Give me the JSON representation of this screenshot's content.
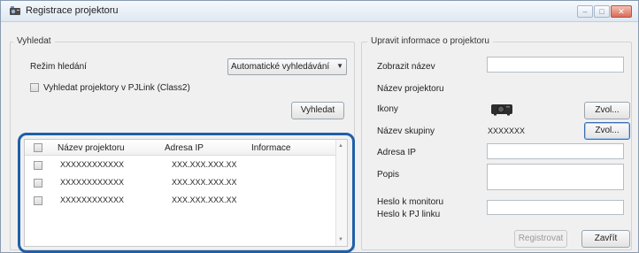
{
  "window": {
    "title": "Registrace projektoru",
    "min_symbol": "–",
    "max_symbol": "□",
    "close_symbol": "✕"
  },
  "search": {
    "group_title": "Vyhledat",
    "mode_label": "Režim hledání",
    "mode_value": "Automatické vyhledávání",
    "mode_arrow": "▼",
    "pjlink_label": "Vyhledat projektory v PJLink (Class2)",
    "search_button": "Vyhledat"
  },
  "list": {
    "columns": [
      "Název projektoru",
      "Adresa IP",
      "Informace"
    ],
    "rows": [
      {
        "name": "XXXXXXXXXXXX",
        "ip": "XXX.XXX.XXX.XX",
        "info": ""
      },
      {
        "name": "XXXXXXXXXXXX",
        "ip": "XXX.XXX.XXX.XX",
        "info": ""
      },
      {
        "name": "XXXXXXXXXXXX",
        "ip": "XXX.XXX.XXX.XX",
        "info": ""
      }
    ],
    "scroll_up": "▲",
    "scroll_down": "▼"
  },
  "edit": {
    "group_title": "Upravit informace o projektoru",
    "display_name_label": "Zobrazit název",
    "display_name_value": "",
    "projector_name_label": "Název projektoru",
    "icons_label": "Ikony",
    "icons_button": "Zvol...",
    "group_name_label": "Název skupiny",
    "group_name_value": "XXXXXXX",
    "group_button": "Zvol...",
    "ip_label": "Adresa IP",
    "ip_value": "",
    "description_label": "Popis",
    "description_value": "",
    "monitor_password_label": "Heslo k monitoru",
    "pjlink_password_label": "Heslo k PJ linku",
    "register_button": "Registrovat",
    "close_button": "Zavřít"
  },
  "colors": {
    "highlight": "#1f5fa8"
  }
}
